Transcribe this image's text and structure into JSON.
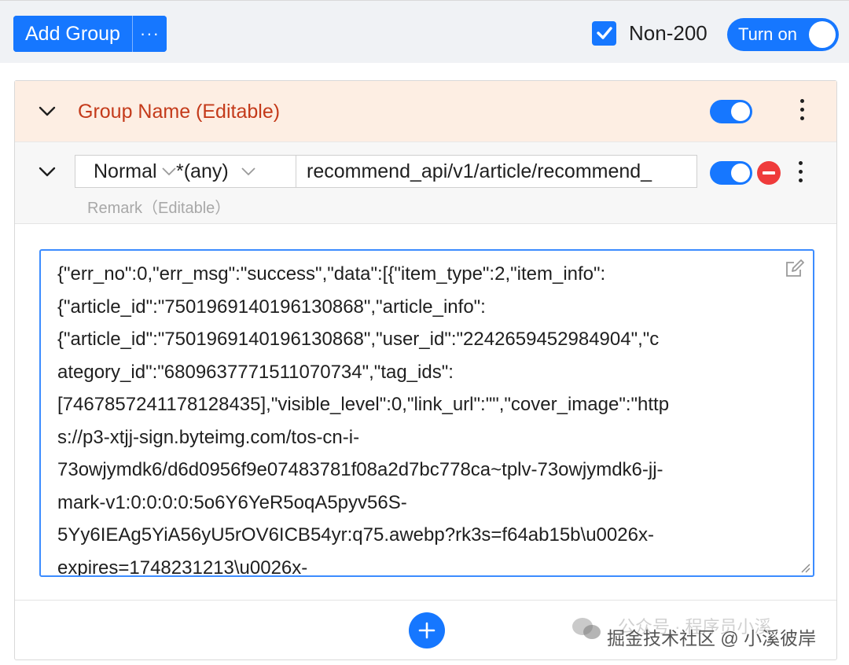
{
  "toolbar": {
    "add_group_label": "Add Group",
    "more_label": "···",
    "non200_label": "Non-200",
    "non200_checked": true,
    "turn_on_label": "Turn on",
    "turn_on_state": true
  },
  "group": {
    "name": "Group Name (Editable)",
    "enabled": true,
    "expanded": true
  },
  "rule": {
    "method": "Normal",
    "match": "*(any)",
    "url": "recommend_api/v1/article/recommend_",
    "remark": "Remark（Editable）",
    "enabled": true
  },
  "response": {
    "lines": [
      "{\"err_no\":0,\"err_msg\":\"success\",\"data\":[{\"item_type\":2,\"item_info\":",
      "{\"article_id\":\"7501969140196130868\",\"article_info\":",
      "{\"article_id\":\"7501969140196130868\",\"user_id\":\"2242659452984904\",\"c",
      "ategory_id\":\"6809637771511070734\",\"tag_ids\":",
      "[7467857241178128435],\"visible_level\":0,\"link_url\":\"\",\"cover_image\":\"http",
      "s://p3-xtjj-sign.byteimg.com/tos-cn-i-",
      "73owjymdk6/d6d0956f9e07483781f08a2d7bc778ca~tplv-73owjymdk6-jj-",
      "mark-v1:0:0:0:0:5o6Y6YeR5oqA5pyv56S-",
      "5Yy6IEAg5YiA56yU5rOV6ICB54yr:q75.awebp?rk3s=f64ab15b\\u0026x-",
      "expires=1748231213\\u0026x-"
    ]
  },
  "watermark": {
    "line1": "公众号 · 程序员小溪",
    "line2": "掘金技术社区 @ 小溪彼岸"
  },
  "colors": {
    "primary": "#1677ff",
    "group_header_bg": "#fdeee3",
    "group_name": "#c43a1a",
    "danger": "#ef3b3b"
  }
}
